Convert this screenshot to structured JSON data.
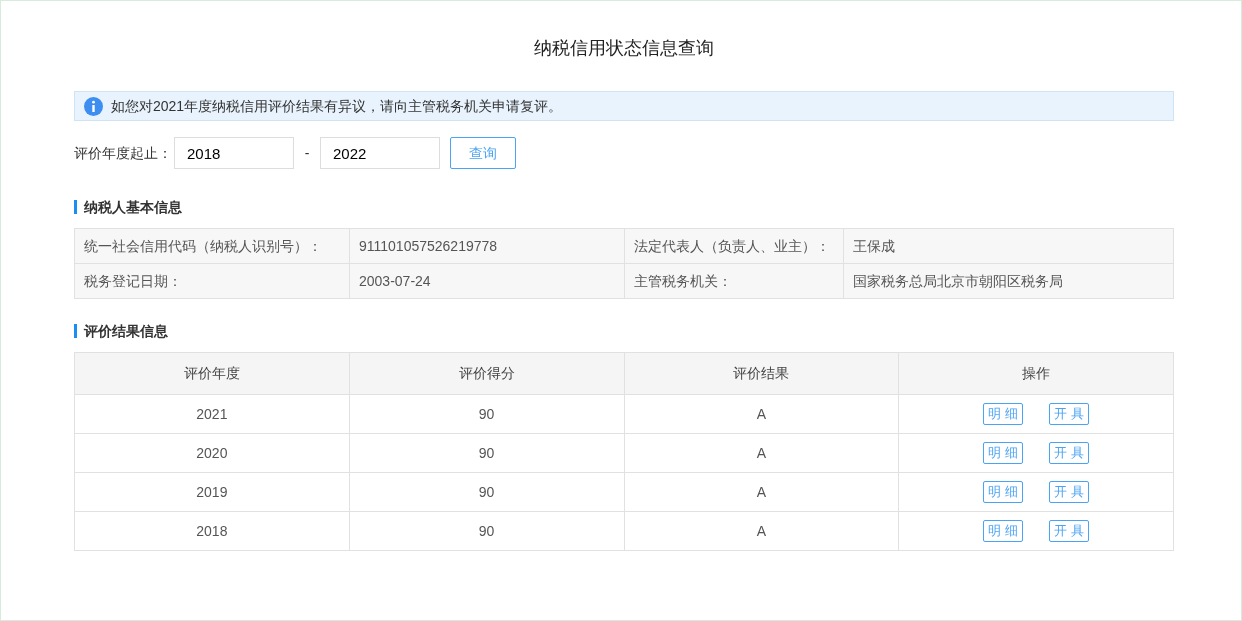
{
  "title": "纳税信用状态信息查询",
  "notice": "如您对2021年度纳税信用评价结果有异议，请向主管税务机关申请复评。",
  "query": {
    "label": "评价年度起止：",
    "from": "2018",
    "separator": "-",
    "to": "2022",
    "button": "查询"
  },
  "basic_info": {
    "heading": "纳税人基本信息",
    "rows": [
      [
        "统一社会信用代码（纳税人识别号）：",
        "911101057526219778",
        "法定代表人（负责人、业主）：",
        "王保成"
      ],
      [
        "税务登记日期：",
        "2003-07-24",
        "主管税务机关：",
        "国家税务总局北京市朝阳区税务局"
      ]
    ]
  },
  "results": {
    "heading": "评价结果信息",
    "columns": [
      "评价年度",
      "评价得分",
      "评价结果",
      "操作"
    ],
    "rows": [
      {
        "year": "2021",
        "score": "90",
        "result": "A",
        "actions": [
          "明细",
          "开具"
        ]
      },
      {
        "year": "2020",
        "score": "90",
        "result": "A",
        "actions": [
          "明细",
          "开具"
        ]
      },
      {
        "year": "2019",
        "score": "90",
        "result": "A",
        "actions": [
          "明细",
          "开具"
        ]
      },
      {
        "year": "2018",
        "score": "90",
        "result": "A",
        "actions": [
          "明细",
          "开具"
        ]
      }
    ]
  }
}
